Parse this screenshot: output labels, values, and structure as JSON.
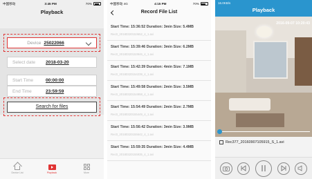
{
  "screen1": {
    "status": {
      "carrier": "中国移动",
      "time": "3:45 PM",
      "battery": "70%"
    },
    "title": "Playback",
    "device": {
      "label": "Device",
      "value": "25022066"
    },
    "select_date": {
      "label": "Select date",
      "value": "2018-03-20"
    },
    "start_time": {
      "label": "Start Time",
      "value": "00:00:00"
    },
    "end_time": {
      "label": "End Time",
      "value": "23:59:59"
    },
    "search_label": "Search for files",
    "tabs": [
      {
        "label": "Device List",
        "icon": "home-icon"
      },
      {
        "label": "Playback",
        "icon": "playback-icon"
      },
      {
        "label": "More",
        "icon": "more-grid-icon"
      }
    ],
    "accent": "#e03434"
  },
  "screen2": {
    "status": {
      "carrier": "中国移动",
      "network": "4G",
      "time": "4:15 PM",
      "battery": "70%"
    },
    "title": "Record File List",
    "records": [
      {
        "main": "Start Time: 15:36:52  Duration: 3min  Size: 5.4MB",
        "file": "Rec0_20180320153652_4_1.avi"
      },
      {
        "main": "Start Time: 15:39:46  Duration: 3min  Size: 6.2MB",
        "file": "Rec0_20180320153946_4_1.avi"
      },
      {
        "main": "Start Time: 15:42:39  Duration: 4min  Size: 7.1MB",
        "file": "Rec0_20180320154239_4_1.avi"
      },
      {
        "main": "Start Time: 15:49:58  Duration: 2min  Size: 3.5MB",
        "file": "Rec0_20180320154958_4_1.avi"
      },
      {
        "main": "Start Time: 15:54:49  Duration: 2min  Size: 2.7MB",
        "file": "Rec0_20180320155449_4_1.avi"
      },
      {
        "main": "Start Time: 15:56:42  Duration: 3min  Size: 3.9MB",
        "file": "Rec0_20180320155642_4_1.avi"
      },
      {
        "main": "Start Time: 15:59:35  Duration: 3min  Size: 4.4MB",
        "file": "Rec0_20180320155935_4_1.avi"
      }
    ]
  },
  "screen3": {
    "status": {
      "speed": "16.0KB/s"
    },
    "title": "Playback",
    "osd_timestamp": "2016-09-07 10:20:43",
    "progress_fraction": 0.0,
    "filename": "Rec377_20160907105915_S_1.avi",
    "controls": [
      "camera-icon",
      "previous-icon",
      "pause-icon",
      "next-icon",
      "volume-icon"
    ],
    "accent": "#2a95ce"
  }
}
